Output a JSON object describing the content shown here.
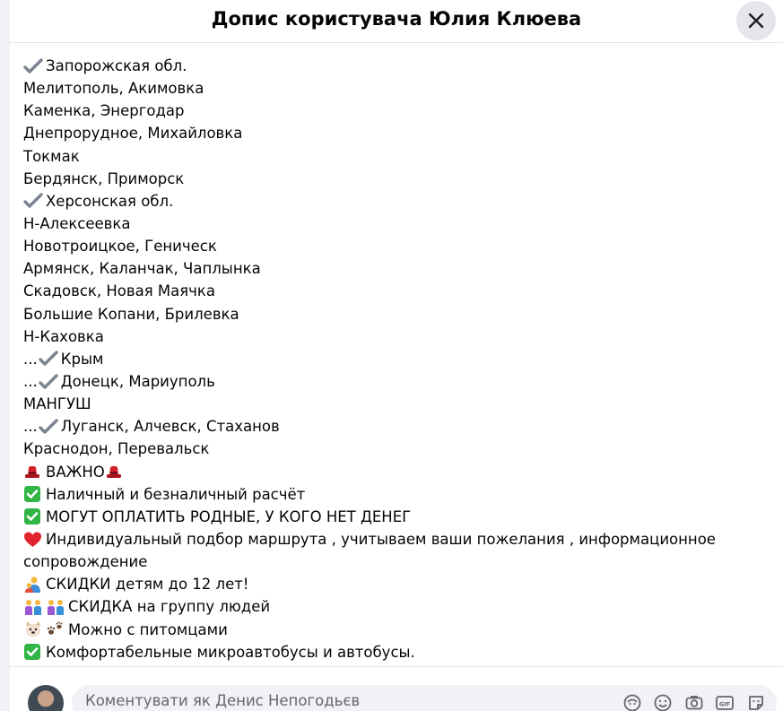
{
  "dialog": {
    "title": "Допис користувача Юлия Клюева",
    "close_label": "✕"
  },
  "post_lines": [
    {
      "icon": "check-mark-icon",
      "prefix": "",
      "text": "Запорожская обл."
    },
    {
      "icon": "",
      "prefix": "",
      "text": "Мелитополь, Акимовка"
    },
    {
      "icon": "",
      "prefix": "",
      "text": "Каменка, Энергодар"
    },
    {
      "icon": "",
      "prefix": "",
      "text": "Днепрорудное, Михайловка"
    },
    {
      "icon": "",
      "prefix": "",
      "text": "Токмак"
    },
    {
      "icon": "",
      "prefix": "",
      "text": "Бердянск, Приморск"
    },
    {
      "icon": "check-mark-icon",
      "prefix": "",
      "text": "Херсонская обл."
    },
    {
      "icon": "",
      "prefix": "",
      "text": "Н-Алексеевка"
    },
    {
      "icon": "",
      "prefix": "",
      "text": "Новотроицкое, Геническ"
    },
    {
      "icon": "",
      "prefix": "",
      "text": "Армянск, Каланчак, Чаплынка"
    },
    {
      "icon": "",
      "prefix": "",
      "text": "Скадовск, Новая Маячка"
    },
    {
      "icon": "",
      "prefix": "",
      "text": "Большие Копани, Брилевка"
    },
    {
      "icon": "",
      "prefix": "",
      "text": "Н-Каховка"
    },
    {
      "icon": "check-mark-icon",
      "prefix": "...",
      "text": "Крым"
    },
    {
      "icon": "check-mark-icon",
      "prefix": "...",
      "text": "Донецк, Мариуполь"
    },
    {
      "icon": "",
      "prefix": "",
      "text": "МАНГУШ"
    },
    {
      "icon": "check-mark-icon",
      "prefix": "...",
      "text": "Луганск, Алчевск, Стаханов"
    },
    {
      "icon": "",
      "prefix": "",
      "text": "Краснодон, Перевальск"
    },
    {
      "icon": "red-hat-icon",
      "prefix": "",
      "text": "ВАЖНО",
      "suffix_icon": "red-hat-icon"
    },
    {
      "icon": "green-check-icon",
      "prefix": "",
      "text": "Наличный и безналичный расчёт"
    },
    {
      "icon": "green-check-icon",
      "prefix": "",
      "text": "МОГУТ ОПЛАТИТЬ РОДНЫЕ, У КОГО НЕТ ДЕНЕГ"
    },
    {
      "icon": "red-heart-icon",
      "prefix": "",
      "text": "Индивидуальный подбор маршрута , учитываем ваши пожелания , информационное сопровождение",
      "wrap": true
    },
    {
      "icon": "parent-child-icon",
      "prefix": "",
      "text": "СКИДКИ детям до 12 лет!"
    },
    {
      "icon": "people-group-icon",
      "prefix": "",
      "text": "СКИДКА на группу людей",
      "double_icon": true
    },
    {
      "icon": "dog-face-icon",
      "prefix": "",
      "text": "Можно с питомцами",
      "second_icon": "paw-prints-icon"
    },
    {
      "icon": "green-check-icon",
      "prefix": "",
      "text": "Комфортабельные микроавтобусы и автобусы."
    }
  ],
  "comment": {
    "placeholder": "Коментувати як Денис Непогодьєв",
    "icons": [
      "avatar-sticker-icon",
      "emoji-icon",
      "camera-icon",
      "gif-icon",
      "sticker-icon"
    ]
  },
  "colors": {
    "check_grey": "#7b8390",
    "green_check": "#31b545",
    "heart_red": "#e0242f",
    "hat_red": "#d3212b"
  }
}
